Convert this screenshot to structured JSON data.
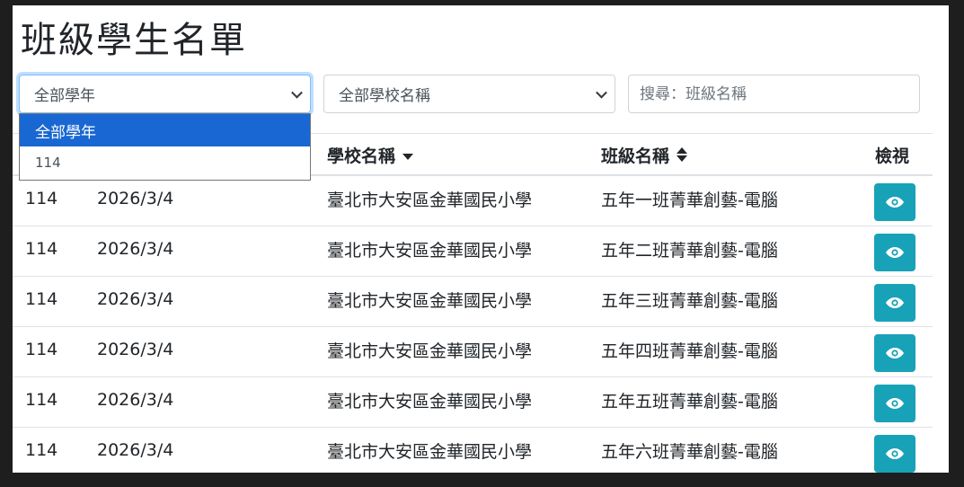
{
  "page": {
    "title": "班級學生名單"
  },
  "filters": {
    "year_select": {
      "value": "全部學年",
      "options": [
        "全部學年",
        "114"
      ]
    },
    "school_select": {
      "value": "全部學校名稱"
    },
    "search": {
      "placeholder": "搜尋：班級名稱"
    }
  },
  "table": {
    "headers": {
      "school": "學校名稱",
      "class": "班級名稱",
      "view": "檢視"
    },
    "rows": [
      {
        "year": "114",
        "date": "2026/3/4",
        "school": "臺北市大安區金華國民小學",
        "class": "五年一班菁華創藝-電腦"
      },
      {
        "year": "114",
        "date": "2026/3/4",
        "school": "臺北市大安區金華國民小學",
        "class": "五年二班菁華創藝-電腦"
      },
      {
        "year": "114",
        "date": "2026/3/4",
        "school": "臺北市大安區金華國民小學",
        "class": "五年三班菁華創藝-電腦"
      },
      {
        "year": "114",
        "date": "2026/3/4",
        "school": "臺北市大安區金華國民小學",
        "class": "五年四班菁華創藝-電腦"
      },
      {
        "year": "114",
        "date": "2026/3/4",
        "school": "臺北市大安區金華國民小學",
        "class": "五年五班菁華創藝-電腦"
      },
      {
        "year": "114",
        "date": "2026/3/4",
        "school": "臺北市大安區金華國民小學",
        "class": "五年六班菁華創藝-電腦"
      }
    ]
  },
  "colors": {
    "view_button": "#17a2b8",
    "dropdown_highlight": "#1967d2"
  },
  "icons": {
    "view": "eye-icon",
    "select_arrow": "chevron-down-icon"
  }
}
